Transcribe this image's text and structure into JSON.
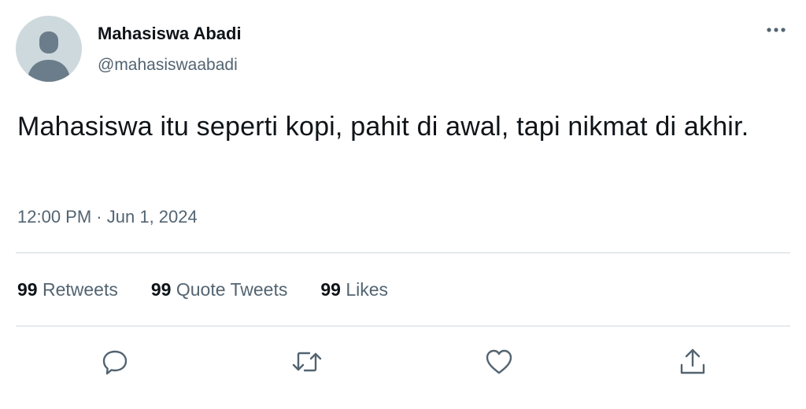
{
  "user": {
    "display_name": "Mahasiswa Abadi",
    "handle": "@mahasiswaabadi"
  },
  "tweet": {
    "text": "Mahasiswa itu seperti kopi, pahit di awal, tapi nikmat di akhir.",
    "time": "12:00 PM",
    "separator": "·",
    "date": "Jun 1, 2024"
  },
  "stats": {
    "retweets_count": "99",
    "retweets_label": "Retweets",
    "quotes_count": "99",
    "quotes_label": "Quote Tweets",
    "likes_count": "99",
    "likes_label": "Likes"
  },
  "icons": {
    "more": "more-horizontal-icon",
    "reply": "reply-bubble-icon",
    "retweet": "retweet-arrows-icon",
    "like": "heart-icon",
    "share": "share-upload-icon"
  },
  "colors": {
    "primary_text": "#0f1419",
    "secondary_text": "#536471",
    "divider": "#cfd9de",
    "avatar_bg": "#cfd9de",
    "avatar_fg": "#657786"
  }
}
